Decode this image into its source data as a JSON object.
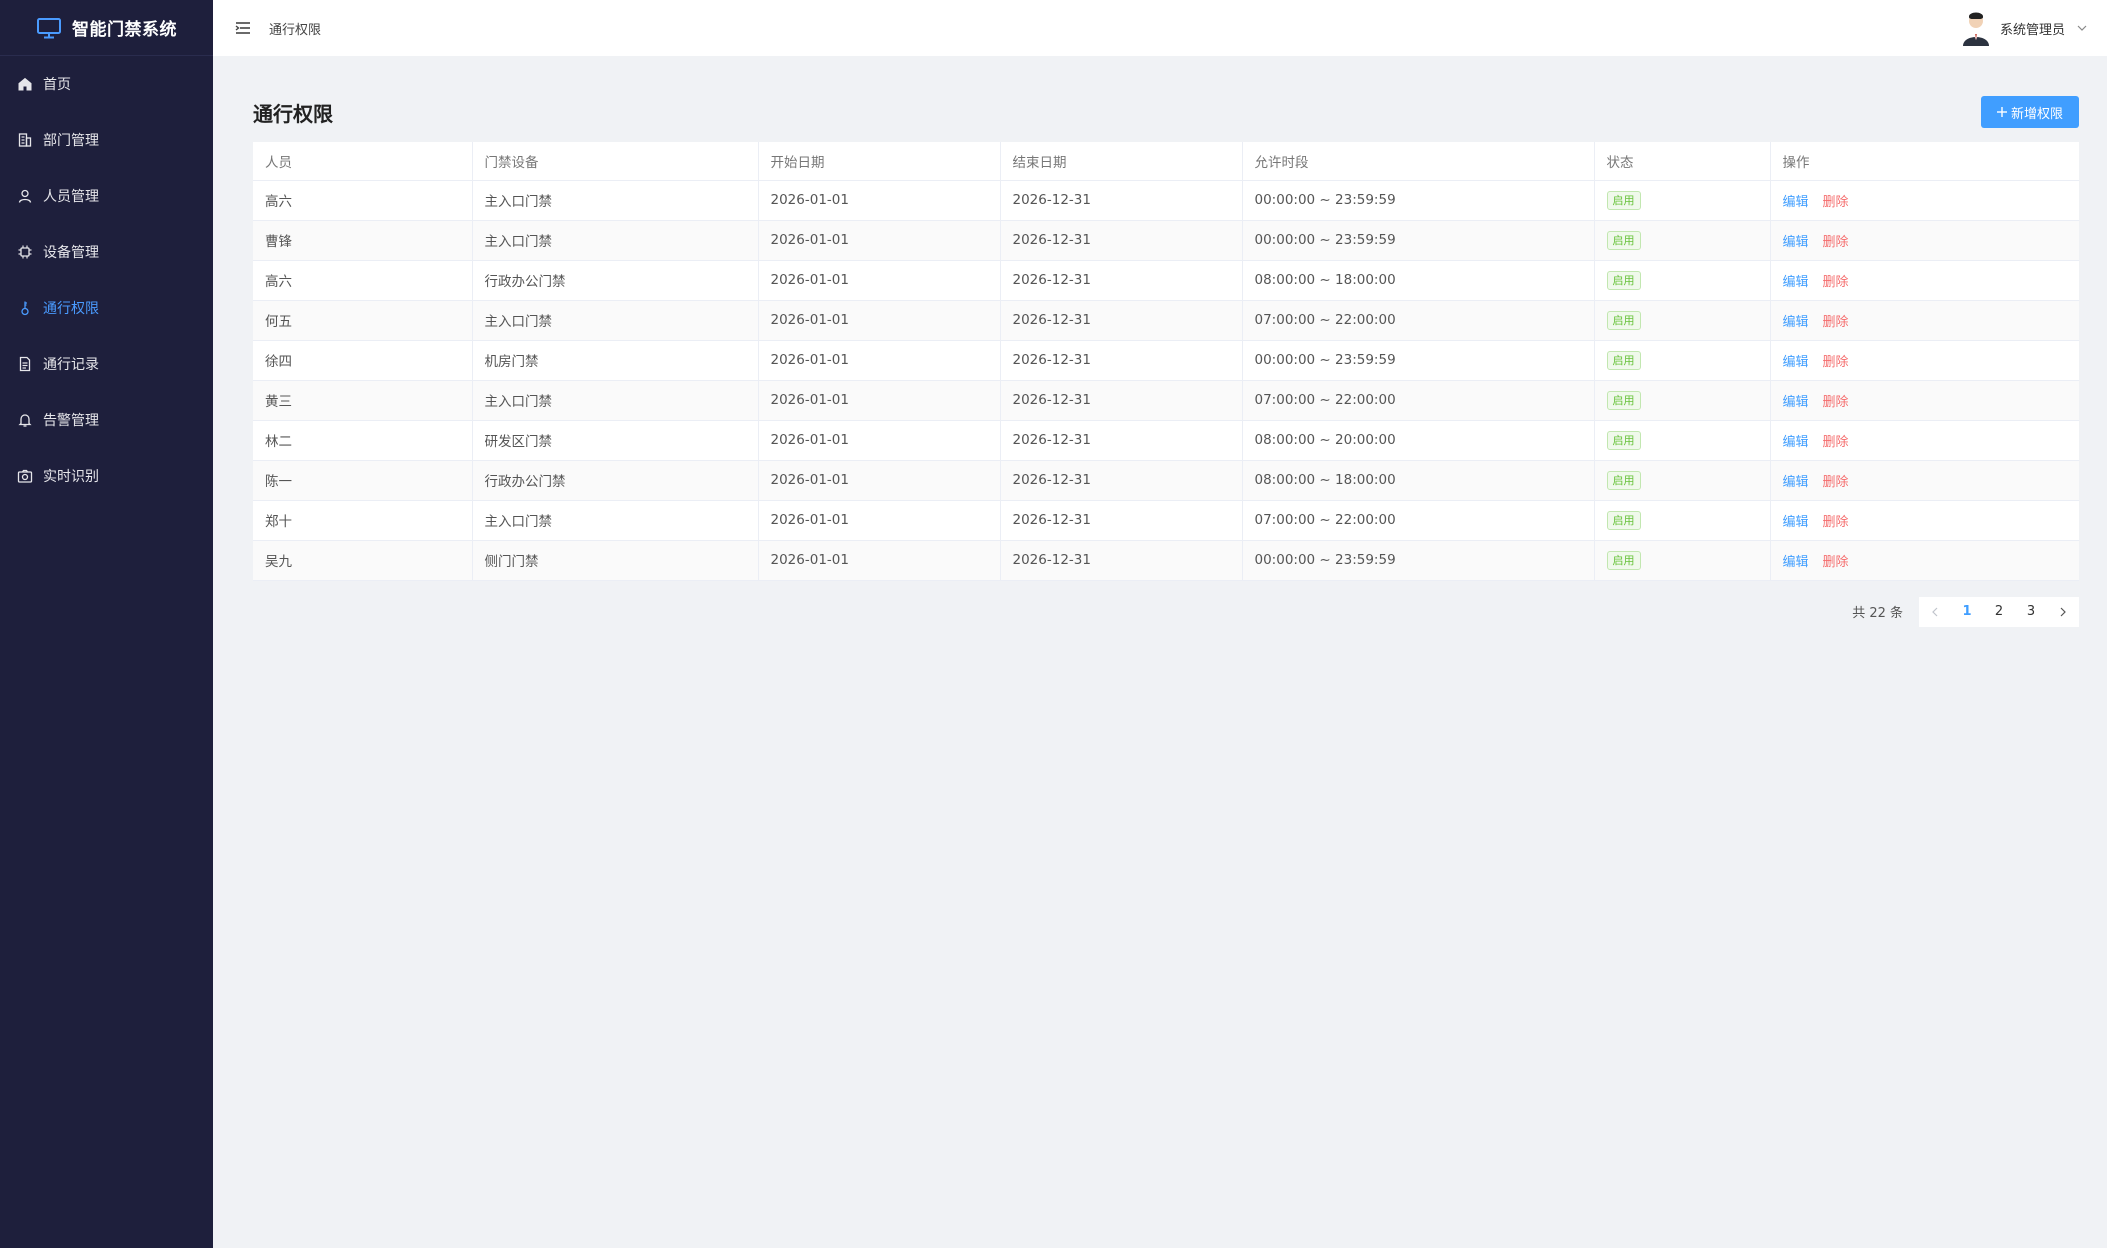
{
  "app": {
    "title": "智能门禁系统"
  },
  "sidebar": {
    "items": [
      {
        "label": "首页",
        "icon": "home-icon",
        "active": false
      },
      {
        "label": "部门管理",
        "icon": "building-icon",
        "active": false
      },
      {
        "label": "人员管理",
        "icon": "user-icon",
        "active": false
      },
      {
        "label": "设备管理",
        "icon": "chip-icon",
        "active": false
      },
      {
        "label": "通行权限",
        "icon": "key-icon",
        "active": true
      },
      {
        "label": "通行记录",
        "icon": "document-icon",
        "active": false
      },
      {
        "label": "告警管理",
        "icon": "bell-icon",
        "active": false
      },
      {
        "label": "实时识别",
        "icon": "camera-icon",
        "active": false
      }
    ]
  },
  "header": {
    "breadcrumb": "通行权限",
    "user_name": "系统管理员"
  },
  "main": {
    "title": "通行权限",
    "add_button_label": "新增权限",
    "columns": [
      "人员",
      "门禁设备",
      "开始日期",
      "结束日期",
      "允许时段",
      "状态",
      "操作"
    ],
    "rows": [
      {
        "person": "高六",
        "device": "主入口门禁",
        "start": "2026-01-01",
        "end": "2026-12-31",
        "period": "00:00:00 ~ 23:59:59",
        "status": "启用"
      },
      {
        "person": "曹锋",
        "device": "主入口门禁",
        "start": "2026-01-01",
        "end": "2026-12-31",
        "period": "00:00:00 ~ 23:59:59",
        "status": "启用"
      },
      {
        "person": "高六",
        "device": "行政办公门禁",
        "start": "2026-01-01",
        "end": "2026-12-31",
        "period": "08:00:00 ~ 18:00:00",
        "status": "启用"
      },
      {
        "person": "何五",
        "device": "主入口门禁",
        "start": "2026-01-01",
        "end": "2026-12-31",
        "period": "07:00:00 ~ 22:00:00",
        "status": "启用"
      },
      {
        "person": "徐四",
        "device": "机房门禁",
        "start": "2026-01-01",
        "end": "2026-12-31",
        "period": "00:00:00 ~ 23:59:59",
        "status": "启用"
      },
      {
        "person": "黄三",
        "device": "主入口门禁",
        "start": "2026-01-01",
        "end": "2026-12-31",
        "period": "07:00:00 ~ 22:00:00",
        "status": "启用"
      },
      {
        "person": "林二",
        "device": "研发区门禁",
        "start": "2026-01-01",
        "end": "2026-12-31",
        "period": "08:00:00 ~ 20:00:00",
        "status": "启用"
      },
      {
        "person": "陈一",
        "device": "行政办公门禁",
        "start": "2026-01-01",
        "end": "2026-12-31",
        "period": "08:00:00 ~ 18:00:00",
        "status": "启用"
      },
      {
        "person": "郑十",
        "device": "主入口门禁",
        "start": "2026-01-01",
        "end": "2026-12-31",
        "period": "07:00:00 ~ 22:00:00",
        "status": "启用"
      },
      {
        "person": "吴九",
        "device": "侧门门禁",
        "start": "2026-01-01",
        "end": "2026-12-31",
        "period": "00:00:00 ~ 23:59:59",
        "status": "启用"
      }
    ],
    "actions": {
      "edit": "编辑",
      "delete": "删除"
    }
  },
  "pagination": {
    "total_text": "共 22 条",
    "pages": [
      "1",
      "2",
      "3"
    ],
    "current": "1"
  },
  "colors": {
    "sidebar_bg": "#1e1f3c",
    "accent": "#409eff",
    "danger": "#f56c6c",
    "success": "#67c23a"
  }
}
